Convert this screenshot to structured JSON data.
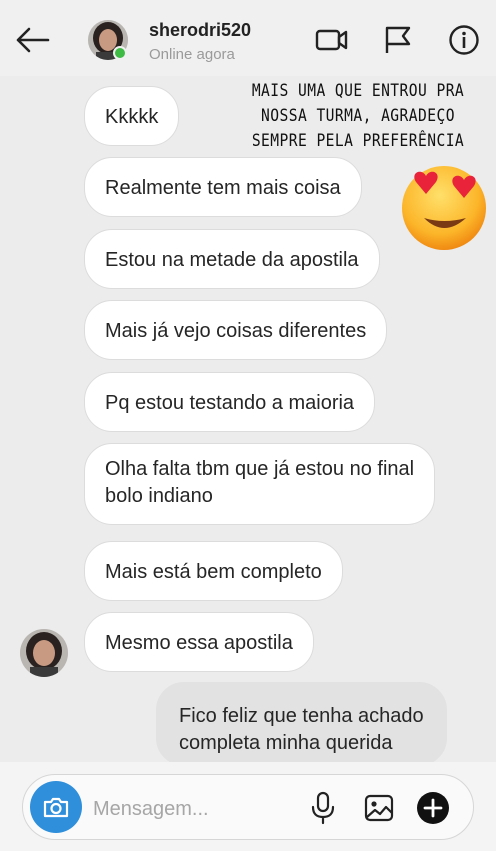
{
  "header": {
    "username": "sherodri520",
    "status": "Online agora",
    "back_icon": "arrow-left-icon",
    "video_icon": "video-camera-icon",
    "flag_icon": "flag-icon",
    "info_icon": "info-icon"
  },
  "overlay": {
    "banner_lines": [
      "MAIS UMA QUE ENTROU PRA",
      "NOSSA TURMA, AGRADEÇO",
      "SEMPRE PELA PREFERÊNCIA"
    ],
    "emoji": "heart-eyes-emoji"
  },
  "messages": [
    {
      "from": "them",
      "lines": [
        "Kkkkk"
      ]
    },
    {
      "from": "them",
      "lines": [
        "Realmente tem mais coisa"
      ]
    },
    {
      "from": "them",
      "lines": [
        "Estou na metade da apostila"
      ]
    },
    {
      "from": "them",
      "lines": [
        "Mais já vejo coisas diferentes"
      ]
    },
    {
      "from": "them",
      "lines": [
        "Pq estou testando a maioria"
      ]
    },
    {
      "from": "them",
      "lines": [
        "Olha falta tbm que já estou no final",
        "bolo indiano"
      ]
    },
    {
      "from": "them",
      "lines": [
        "Mais está bem completo"
      ]
    },
    {
      "from": "them",
      "lines": [
        "Mesmo essa apostila"
      ]
    },
    {
      "from": "me",
      "lines": [
        "Fico feliz que tenha achado",
        "completa minha querida"
      ]
    }
  ],
  "composer": {
    "placeholder": "Mensagem...",
    "camera_icon": "camera-icon",
    "mic_icon": "microphone-icon",
    "gallery_icon": "image-gallery-icon",
    "plus_icon": "plus-circle-icon"
  },
  "colors": {
    "accent": "#2f8fdb",
    "online": "#3dbb45",
    "background": "#ececec"
  }
}
